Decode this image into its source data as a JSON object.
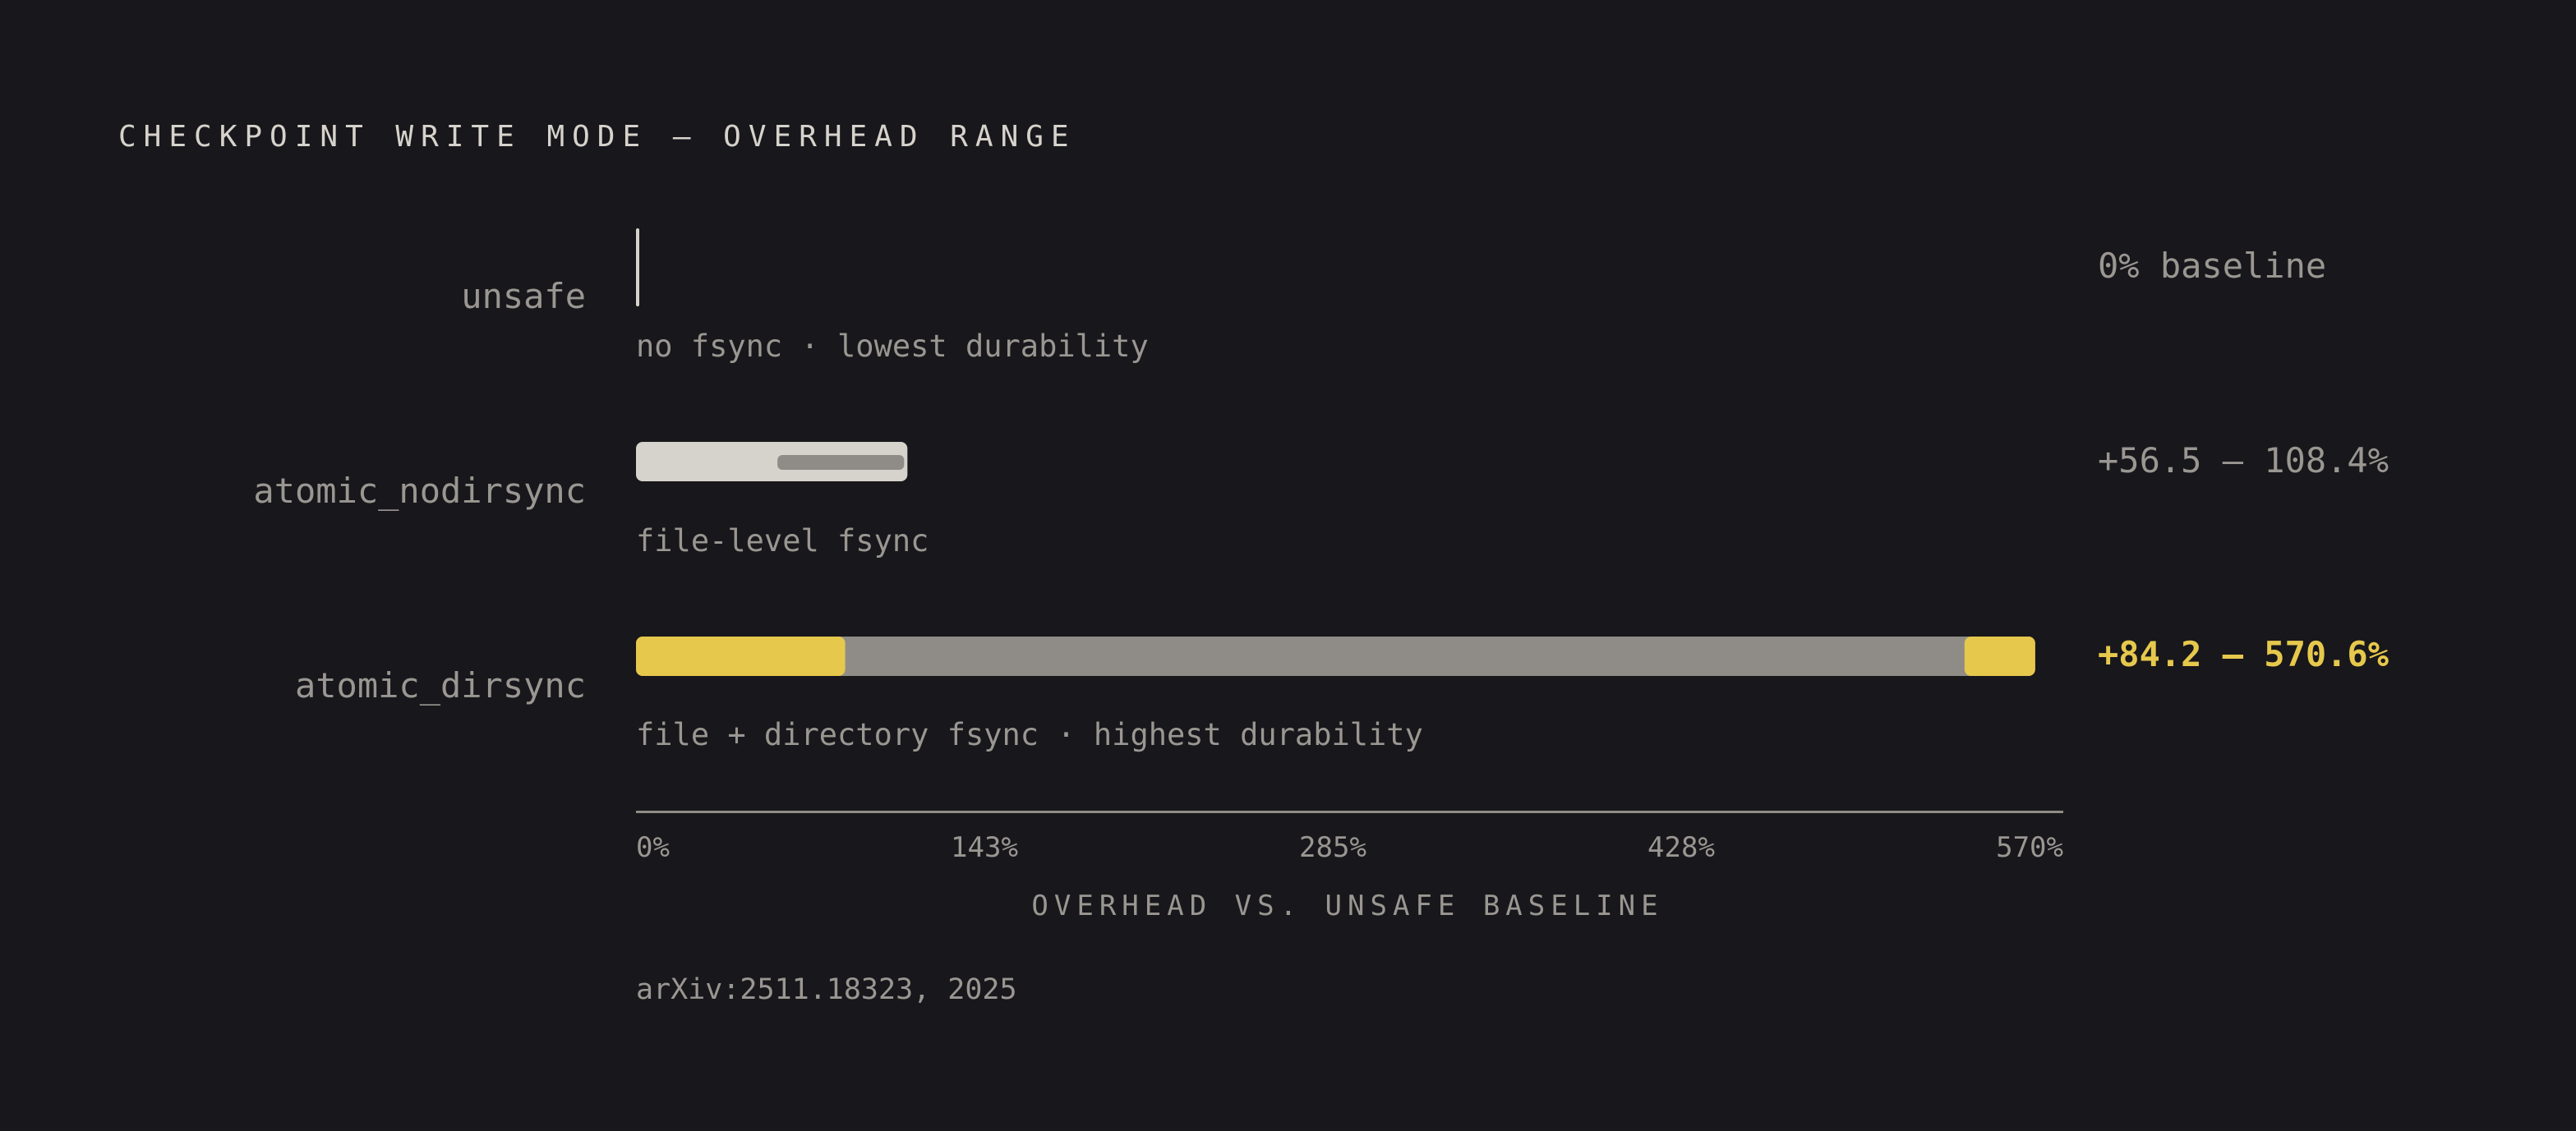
{
  "chart_data": {
    "type": "bar",
    "title": "CHECKPOINT WRITE MODE — OVERHEAD RANGE",
    "xlabel": "OVERHEAD VS. UNSAFE BASELINE",
    "xlim": [
      0,
      570
    ],
    "ticks": [
      "0%",
      "143%",
      "285%",
      "428%",
      "570%"
    ],
    "series": [
      {
        "name": "unsafe",
        "description": "no fsync · lowest durability",
        "range": [
          0,
          0
        ],
        "value_label": "0% baseline",
        "highlight": false
      },
      {
        "name": "atomic_nodirsync",
        "description": "file-level fsync",
        "range": [
          56.5,
          108.4
        ],
        "value_label": "+56.5 – 108.4%",
        "highlight": false
      },
      {
        "name": "atomic_dirsync",
        "description": "file + directory fsync · highest durability",
        "range": [
          84.2,
          570.6
        ],
        "value_label": "+84.2 – 570.6%",
        "highlight": true
      }
    ],
    "source": "arXiv:2511.18323, 2025"
  },
  "colors": {
    "background": "#18171b",
    "bar_fill_light": "#d6d2cc",
    "range_gray": "#8f8c87",
    "accent_yellow": "#e6c84c",
    "axis": "#8f8c87"
  }
}
